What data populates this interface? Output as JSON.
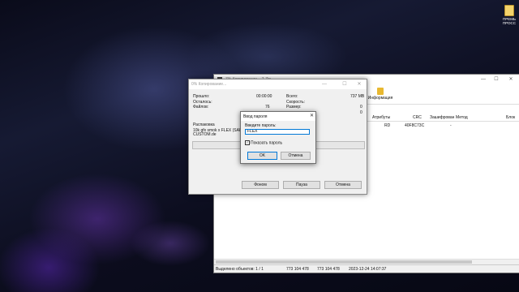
{
  "desktop": {
    "icon_label": "ПРЕМЬ\nПРОСС"
  },
  "archive_window": {
    "title": "7% Копирование... 7-Zip",
    "toolbar": {
      "info_label": "Информация"
    },
    "columns": [
      "Атрибуты",
      "CRC",
      "Зашифрован",
      "Метод",
      "Блок"
    ],
    "row": {
      "attributes": "RD",
      "crc": "40F8C73C",
      "encrypted": "-"
    },
    "status": [
      "Выделено объектов: 1 / 1",
      "773 104 478",
      "773 104 478",
      "2023-12-24 14:07:37"
    ]
  },
  "copy_window": {
    "title": "0% Копирование...",
    "labels": {
      "elapsed": "Прошло:",
      "remaining": "Осталось:",
      "files": "Файлов:",
      "total": "Всего:",
      "speed": "Скорость:",
      "size": "Размер:",
      "extracting": "Распаковка"
    },
    "values": {
      "elapsed": "00:00:00",
      "files": "76",
      "total": "737 MB",
      "speed": "0",
      "size": "0"
    },
    "current_file": "10k gfx smok x FLEX (SARP)\nCUSTOM.de",
    "progress": 0,
    "buttons": {
      "background": "Фоном",
      "pause": "Пауза",
      "cancel": "Отмена"
    }
  },
  "password_dialog": {
    "title": "Ввод пароля",
    "prompt": "Введите пароль:",
    "value": "FLEX",
    "show_password_label": "Показать пароль",
    "show_password_checked": true,
    "ok_label": "OK",
    "cancel_label": "Отмена"
  }
}
